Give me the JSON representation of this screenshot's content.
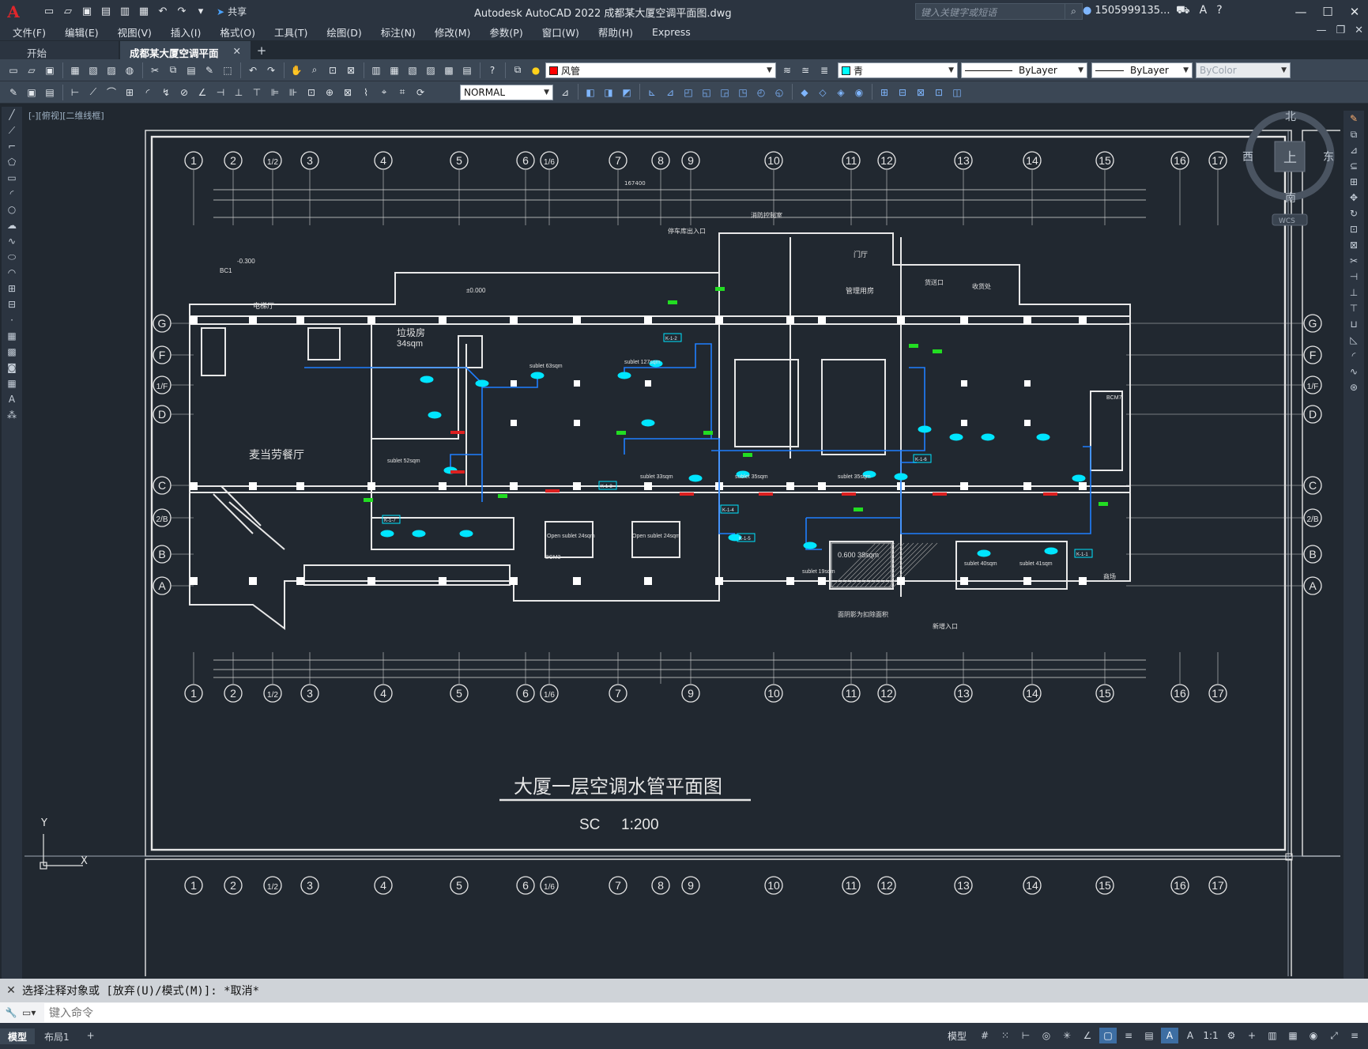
{
  "app": {
    "title": "Autodesk AutoCAD 2022    成都某大厦空调平面图.dwg",
    "logo": "A",
    "share_label": "共享",
    "search_placeholder": "键入关键字或短语",
    "user": "1505999135...",
    "window_controls": [
      "—",
      "☐",
      "✕"
    ]
  },
  "menu": [
    "文件(F)",
    "编辑(E)",
    "视图(V)",
    "插入(I)",
    "格式(O)",
    "工具(T)",
    "绘图(D)",
    "标注(N)",
    "修改(M)",
    "参数(P)",
    "窗口(W)",
    "帮助(H)",
    "Express"
  ],
  "tabs": [
    {
      "label": "开始"
    },
    {
      "label": "成都某大厦空调平面图*"
    }
  ],
  "toolbar": {
    "layer_name": "风管",
    "layer_color": "#ff0000",
    "color_name": "青",
    "color_swatch": "#00ffff",
    "linetype": "ByLayer",
    "lineweight": "ByLayer",
    "plotstyle": "ByColor",
    "textstyle": "NORMAL"
  },
  "viewport": {
    "label": "[-][俯视][二维线框]"
  },
  "viewcube": {
    "north": "北",
    "south": "南",
    "east": "东",
    "west": "西",
    "top": "上",
    "wcs": "WCS"
  },
  "drawing": {
    "title": "大厦一层空调水管平面图",
    "scale_prefix": "SC",
    "scale": "1:200",
    "axis_top": [
      "1",
      "2",
      "1/2",
      "3",
      "4",
      "5",
      "6",
      "1/6",
      "7",
      "8",
      "9",
      "10",
      "11",
      "12",
      "13",
      "14",
      "15",
      "16",
      "17"
    ],
    "axis_bottom": [
      "1",
      "2",
      "1/2",
      "3",
      "4",
      "5",
      "6",
      "1/6",
      "7",
      "9",
      "10",
      "11",
      "12",
      "13",
      "14",
      "15",
      "16",
      "17"
    ],
    "axis_left": [
      "G",
      "F",
      "1/F",
      "D",
      "C",
      "2/B",
      "B",
      "A"
    ],
    "total_dim": "167400",
    "rooms": [
      {
        "label": "麦当劳餐厅"
      },
      {
        "label": "垃圾房"
      },
      {
        "label": "34sqm"
      },
      {
        "label": "电梯厅"
      },
      {
        "label": "管理用房"
      },
      {
        "label": "门厅"
      },
      {
        "label": "商场"
      },
      {
        "label": "新增入口"
      },
      {
        "label": "面阴影为扣除面积"
      },
      {
        "label": "sublet 63sqm"
      },
      {
        "label": "sublet 127sqm"
      },
      {
        "label": "sublet 52sqm"
      },
      {
        "label": "sublet 33sqm"
      },
      {
        "label": "sublet 35sqm"
      },
      {
        "label": "sublet 35sqm"
      },
      {
        "label": "Open sublet 24sqm"
      },
      {
        "label": "Open sublet 24sqm"
      },
      {
        "label": "sublet 40sqm"
      },
      {
        "label": "sublet 41sqm"
      },
      {
        "label": "sublet 19sqm"
      },
      {
        "label": "0.600 38sqm"
      },
      {
        "label": "±0.000"
      },
      {
        "label": "停车库出入口"
      },
      {
        "label": "消防控制室"
      },
      {
        "label": "货送口"
      },
      {
        "label": "收货处"
      },
      {
        "label": "BC1"
      },
      {
        "label": "-0.300"
      },
      {
        "label": "BCM3"
      },
      {
        "label": "BCM7"
      }
    ],
    "tags": [
      "K-1-2",
      "K-1-3",
      "K-1-4",
      "K-1-5",
      "K-1-6",
      "K-1-7",
      "K-1-1"
    ]
  },
  "command": {
    "history": "选择注释对象或 [放弃(U)/模式(M)]: *取消*",
    "placeholder": "键入命令"
  },
  "status": {
    "tabs": [
      "模型",
      "布局1"
    ],
    "model_label": "模型",
    "scale": "1:1"
  }
}
